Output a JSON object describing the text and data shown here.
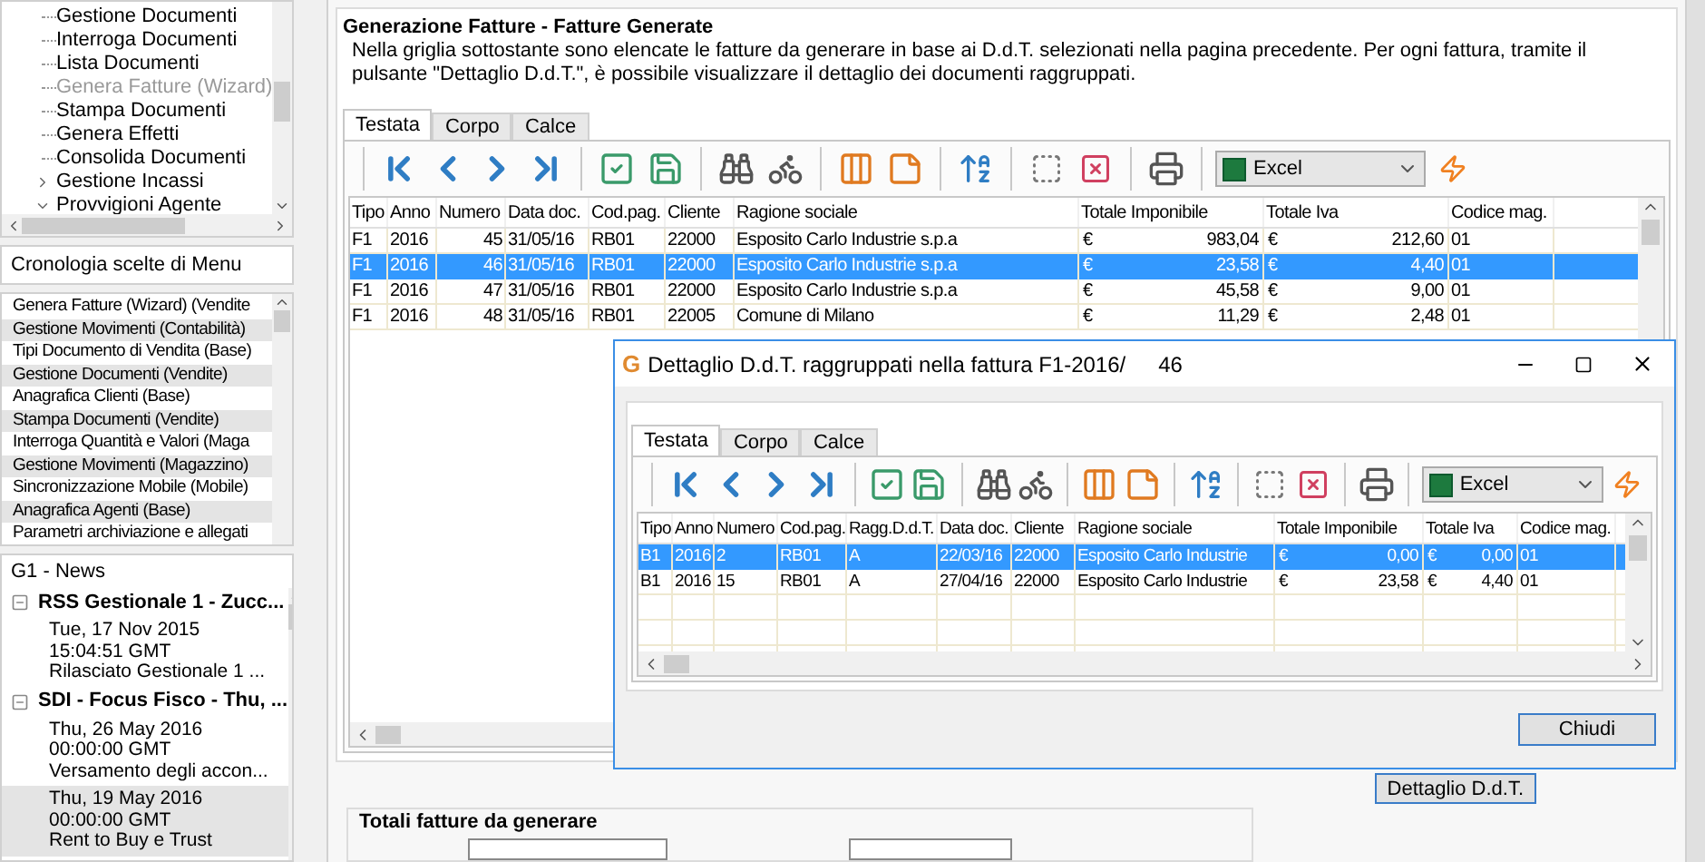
{
  "sidebar": {
    "menu_tree": [
      {
        "label": "Gestione Documenti",
        "kind": "leaf",
        "disabled": false
      },
      {
        "label": "Interroga Documenti",
        "kind": "leaf",
        "disabled": false
      },
      {
        "label": "Lista Documenti",
        "kind": "leaf",
        "disabled": false
      },
      {
        "label": "Genera Fatture (Wizard)",
        "kind": "leaf",
        "disabled": true
      },
      {
        "label": "Stampa Documenti",
        "kind": "leaf",
        "disabled": false
      },
      {
        "label": "Genera Effetti",
        "kind": "leaf",
        "disabled": false
      },
      {
        "label": "Consolida Documenti",
        "kind": "leaf",
        "disabled": false
      },
      {
        "label": "Gestione Incassi",
        "kind": "folder",
        "expanded": false,
        "disabled": false
      },
      {
        "label": "Provvigioni Agente",
        "kind": "folder",
        "expanded": true,
        "disabled": false
      }
    ],
    "history": {
      "title": "Cronologia scelte di Menu",
      "items": [
        "Genera Fatture (Wizard) (Vendite",
        "Gestione Movimenti (Contabilità)",
        "Tipi Documento di Vendita (Base)",
        "Gestione Documenti (Vendite)",
        "Anagrafica Clienti (Base)",
        "Stampa Documenti (Vendite)",
        "Interroga Quantità e Valori (Maga",
        "Gestione Movimenti (Magazzino)",
        "Sincronizzazione Mobile (Mobile)",
        "Anagrafica Agenti (Base)",
        "Parametri archiviazione e allegati"
      ]
    },
    "news": {
      "title": "G1 - News",
      "feeds": [
        {
          "title": "RSS Gestionale 1 - Zucc...",
          "expanded": true,
          "items": [
            {
              "lines": [
                "Tue, 17 Nov 2015",
                "15:04:51 GMT",
                "Rilasciato Gestionale 1 ..."
              ],
              "selected": false
            }
          ]
        },
        {
          "title": "SDI - Focus Fisco - Thu, ...",
          "expanded": true,
          "items": [
            {
              "lines": [
                "Thu, 26 May 2016",
                "00:00:00 GMT",
                "Versamento degli accon..."
              ],
              "selected": false
            },
            {
              "lines": [
                "Thu, 19 May 2016",
                "00:00:00 GMT",
                "Rent to Buy e Trust"
              ],
              "selected": true
            }
          ]
        }
      ]
    }
  },
  "main": {
    "title": "Generazione Fatture - Fatture Generate",
    "description": "Nella griglia sottostante sono elencate le fatture da generare in base ai D.d.T. selezionati nella pagina precedente. Per ogni fattura, tramite il pulsante \"Dettaglio D.d.T.\", è possibile visualizzare il dettaglio dei documenti raggruppati.",
    "tabs": [
      {
        "label": "Testata",
        "selected": true
      },
      {
        "label": "Corpo",
        "selected": false
      },
      {
        "label": "Calce",
        "selected": false
      }
    ],
    "export_format": "Excel",
    "grid": {
      "columns": [
        "Tipo",
        "Anno",
        "Numero",
        "Data doc.",
        "Cod.pag.",
        "Cliente",
        "Ragione sociale",
        "Totale Imponibile",
        "Totale Iva",
        "Codice mag."
      ],
      "rows": [
        {
          "selected": false,
          "cells": [
            "F1",
            "2016",
            "45",
            "31/05/16",
            "RB01",
            "22000",
            "Esposito Carlo Industrie s.p.a",
            {
              "currency": "€",
              "amount": "983,04"
            },
            {
              "currency": "€",
              "amount": "212,60"
            },
            "01"
          ]
        },
        {
          "selected": true,
          "cells": [
            "F1",
            "2016",
            "46",
            "31/05/16",
            "RB01",
            "22000",
            "Esposito Carlo Industrie s.p.a",
            {
              "currency": "€",
              "amount": "23,58"
            },
            {
              "currency": "€",
              "amount": "4,40"
            },
            "01"
          ]
        },
        {
          "selected": false,
          "cells": [
            "F1",
            "2016",
            "47",
            "31/05/16",
            "RB01",
            "22000",
            "Esposito Carlo Industrie s.p.a",
            {
              "currency": "€",
              "amount": "45,58"
            },
            {
              "currency": "€",
              "amount": "9,00"
            },
            "01"
          ]
        },
        {
          "selected": false,
          "cells": [
            "F1",
            "2016",
            "48",
            "31/05/16",
            "RB01",
            "22005",
            "Comune di Milano",
            {
              "currency": "€",
              "amount": "11,29"
            },
            {
              "currency": "€",
              "amount": "2,48"
            },
            "01"
          ]
        }
      ]
    },
    "detail_button": "Dettaglio D.d.T.",
    "totals_title": "Totali fatture da generare"
  },
  "dialog": {
    "logo": "G",
    "title": "Dettaglio D.d.T. raggruppati nella fattura F1-2016/",
    "number": "46",
    "tabs": [
      {
        "label": "Testata",
        "selected": true
      },
      {
        "label": "Corpo",
        "selected": false
      },
      {
        "label": "Calce",
        "selected": false
      }
    ],
    "export_format": "Excel",
    "grid": {
      "columns": [
        "Tipo",
        "Anno",
        "Numero",
        "Cod.pag.",
        "Ragg.D.d.T.",
        "Data doc.",
        "Cliente",
        "Ragione sociale",
        "Totale Imponibile",
        "Totale Iva",
        "Codice mag."
      ],
      "rows": [
        {
          "selected": true,
          "cells": [
            "B1",
            "2016",
            "2",
            "RB01",
            "A",
            "22/03/16",
            "22000",
            "Esposito Carlo Industrie",
            {
              "currency": "€",
              "amount": "0,00"
            },
            {
              "currency": "€",
              "amount": "0,00"
            },
            "01"
          ]
        },
        {
          "selected": false,
          "cells": [
            "B1",
            "2016",
            "15",
            "RB01",
            "A",
            "27/04/16",
            "22000",
            "Esposito Carlo Industrie",
            {
              "currency": "€",
              "amount": "23,58"
            },
            {
              "currency": "€",
              "amount": "4,40"
            },
            "01"
          ]
        }
      ]
    },
    "close_button": "Chiudi"
  }
}
